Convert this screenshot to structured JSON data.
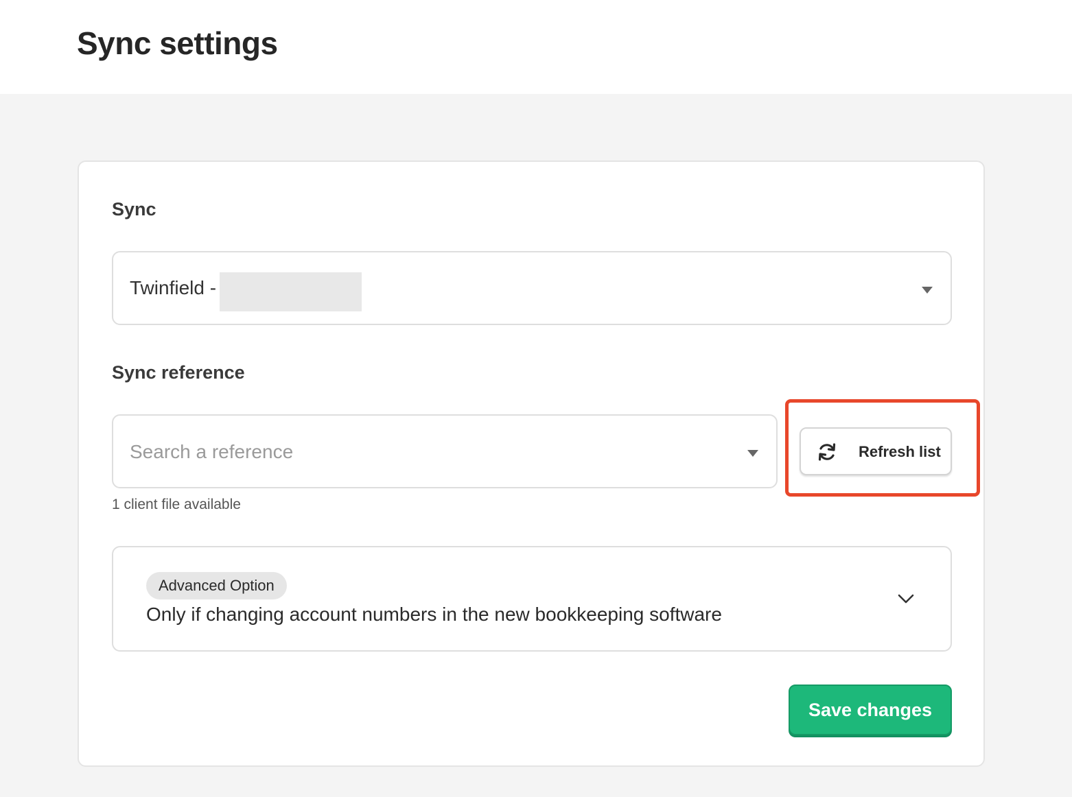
{
  "page": {
    "title": "Sync settings"
  },
  "sync": {
    "label": "Sync",
    "selected_value": "Twinfield -"
  },
  "sync_reference": {
    "label": "Sync reference",
    "placeholder": "Search a reference",
    "value": "",
    "helper_text": "1 client file available",
    "refresh_label": "Refresh list",
    "refresh_icon": "refresh-icon"
  },
  "advanced": {
    "badge": "Advanced Option",
    "description": "Only if changing account numbers in the new bookkeeping software",
    "expand_icon": "chevron-down-icon"
  },
  "actions": {
    "save_label": "Save changes"
  },
  "colors": {
    "primary": "#1db87a",
    "highlight": "#e8472b",
    "background": "#f4f4f4"
  }
}
